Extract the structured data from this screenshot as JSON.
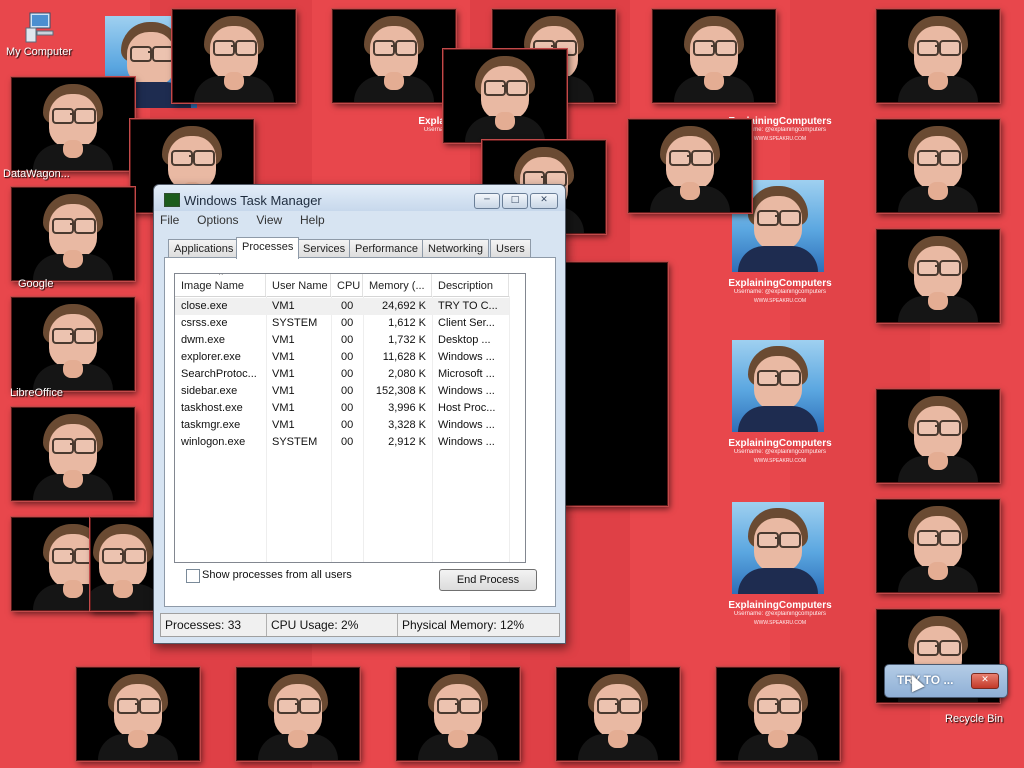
{
  "desktop": {
    "icons": [
      {
        "label": "My Computer",
        "icon": "computer-icon"
      },
      {
        "label": "DataWagon...",
        "icon": "shortcut-icon"
      },
      {
        "label": "Google",
        "icon": "shortcut-icon"
      },
      {
        "label": "LibreOffice",
        "icon": "shortcut-icon"
      },
      {
        "label": "Recycle Bin",
        "icon": "recycle-bin-icon"
      }
    ],
    "wallpaper_caption": {
      "brand": "ExplainingComputers",
      "username": "Username: @explainingcomputers",
      "url": "WWW.SPEAKRU.COM"
    }
  },
  "task_manager": {
    "title": "Windows Task Manager",
    "menu": [
      "File",
      "Options",
      "View",
      "Help"
    ],
    "tabs": [
      "Applications",
      "Processes",
      "Services",
      "Performance",
      "Networking",
      "Users"
    ],
    "active_tab": "Processes",
    "columns": [
      "Image Name",
      "User Name",
      "CPU",
      "Memory (...",
      "Description"
    ],
    "processes": [
      {
        "image": "close.exe",
        "user": "VM1",
        "cpu": "00",
        "memory": "24,692 K",
        "desc": "TRY TO C..."
      },
      {
        "image": "csrss.exe",
        "user": "SYSTEM",
        "cpu": "00",
        "memory": "1,612 K",
        "desc": "Client Ser..."
      },
      {
        "image": "dwm.exe",
        "user": "VM1",
        "cpu": "00",
        "memory": "1,732 K",
        "desc": "Desktop ..."
      },
      {
        "image": "explorer.exe",
        "user": "VM1",
        "cpu": "00",
        "memory": "11,628 K",
        "desc": "Windows ..."
      },
      {
        "image": "SearchProtoc...",
        "user": "VM1",
        "cpu": "00",
        "memory": "2,080 K",
        "desc": "Microsoft ..."
      },
      {
        "image": "sidebar.exe",
        "user": "VM1",
        "cpu": "00",
        "memory": "152,308 K",
        "desc": "Windows ..."
      },
      {
        "image": "taskhost.exe",
        "user": "VM1",
        "cpu": "00",
        "memory": "3,996 K",
        "desc": "Host Proc..."
      },
      {
        "image": "taskmgr.exe",
        "user": "VM1",
        "cpu": "00",
        "memory": "3,328 K",
        "desc": "Windows ..."
      },
      {
        "image": "winlogon.exe",
        "user": "SYSTEM",
        "cpu": "00",
        "memory": "2,912 K",
        "desc": "Windows ..."
      }
    ],
    "show_all_label": "Show processes from all users",
    "end_process_label": "End Process",
    "status": {
      "processes": "Processes: 33",
      "cpu": "CPU Usage: 2%",
      "memory": "Physical Memory: 12%"
    }
  },
  "try_window": {
    "title": "TRY TO ..."
  },
  "colors": {
    "desktop_red": "#e8474c",
    "stripe_dark": "#d83a40",
    "titlebar": "#c7d8ec"
  }
}
